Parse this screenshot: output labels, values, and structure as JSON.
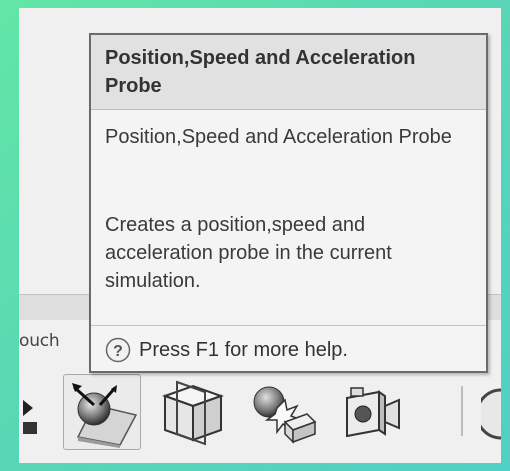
{
  "tooltip": {
    "title": "Position,Speed and Acceleration Probe",
    "subtitle": "Position,Speed and Acceleration Probe",
    "description": "Creates a position,speed and acceleration probe in the current simulation.",
    "help_text": "Press F1 for more help."
  },
  "background": {
    "partial_label": "ouch"
  },
  "toolbar": {
    "buttons": [
      {
        "name": "arrow-icon"
      },
      {
        "name": "position-speed-acceleration-probe-icon",
        "selected": true
      },
      {
        "name": "section-plane-icon"
      },
      {
        "name": "collision-icon"
      },
      {
        "name": "camera-icon"
      },
      {
        "name": "partial-tool-icon"
      }
    ]
  },
  "colors": {
    "backdrop": "#5fe3aa",
    "tooltip_header": "#e1e1e1",
    "tooltip_body": "#f4f4f4",
    "tooltip_border": "#6b6b6b"
  }
}
